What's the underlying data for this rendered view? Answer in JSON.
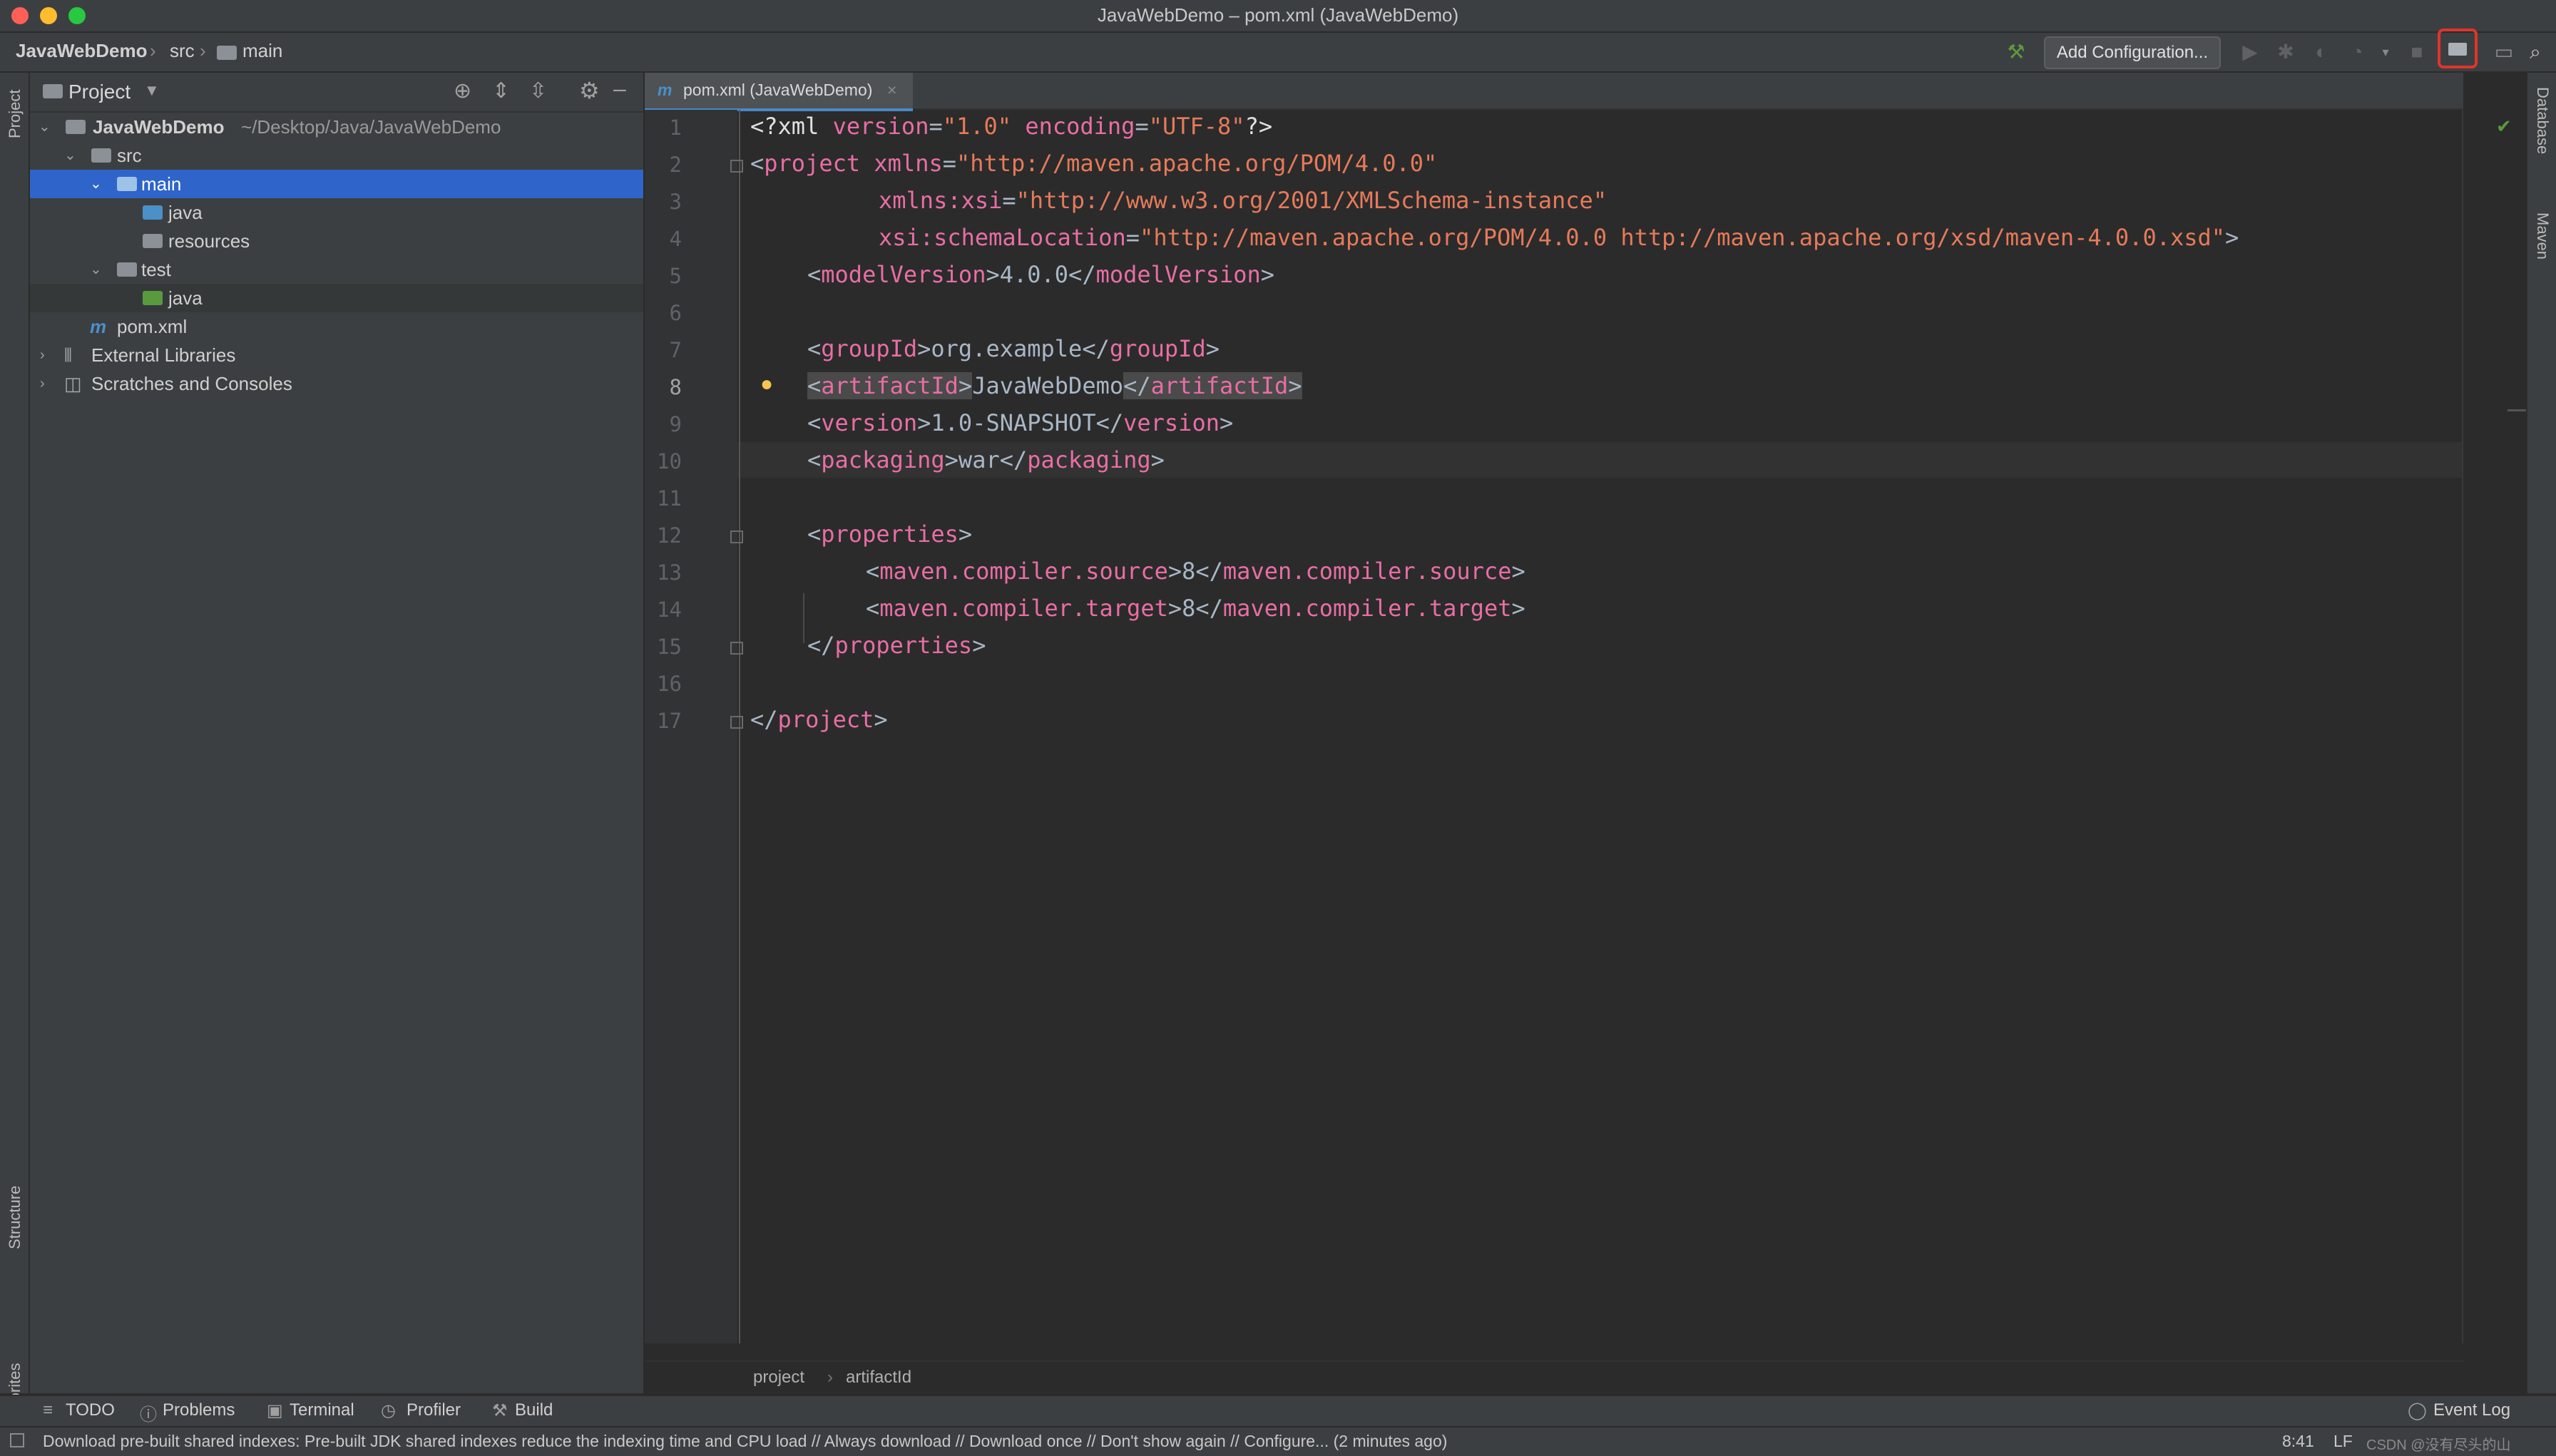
{
  "window": {
    "title": "JavaWebDemo – pom.xml (JavaWebDemo)"
  },
  "breadcrumb": {
    "project": "JavaWebDemo",
    "src": "src",
    "main": "main"
  },
  "toolbar": {
    "add_config_label": "Add Configuration..."
  },
  "left_strip": {
    "project_tab": "Project",
    "structure_tab": "Structure",
    "favorites_tab": "Favorites"
  },
  "right_strip": {
    "database_tab": "Database",
    "maven_tab": "Maven"
  },
  "project_panel": {
    "title": "Project",
    "tree": [
      {
        "label": "JavaWebDemo",
        "hint": "~/Desktop/Java/JavaWebDemo"
      },
      {
        "label": "src"
      },
      {
        "label": "main"
      },
      {
        "label": "java"
      },
      {
        "label": "resources"
      },
      {
        "label": "test"
      },
      {
        "label": "java"
      },
      {
        "label": "pom.xml"
      },
      {
        "label": "External Libraries"
      },
      {
        "label": "Scratches and Consoles"
      }
    ]
  },
  "editor": {
    "tab_label": "pom.xml (JavaWebDemo)",
    "line_numbers": [
      "1",
      "2",
      "3",
      "4",
      "5",
      "6",
      "7",
      "8",
      "9",
      "10",
      "11",
      "12",
      "13",
      "14",
      "15",
      "16",
      "17"
    ],
    "breadcrumb": {
      "first": "project",
      "second": "artifactId"
    },
    "code": {
      "l1_open": "<?xml ",
      "l1_ver_attr": "version",
      "l1_ver_val": "\"1.0\"",
      "l1_enc_attr": " encoding",
      "l1_enc_val": "\"UTF-8\"",
      "l1_close": "?>",
      "l2_tag": "project",
      "l2_attr": " xmlns",
      "l2_val": "\"http://maven.apache.org/POM/4.0.0\"",
      "l3_attr": "xmlns:xsi",
      "l3_val": "\"http://www.w3.org/2001/XMLSchema-instance\"",
      "l4_attr": "xsi:schemaLocation",
      "l4_val": "\"http://maven.apache.org/POM/4.0.0 http://maven.apache.org/xsd/maven-4.0.0.xsd\"",
      "l5_tag": "modelVersion",
      "l5_text": "4.0.0",
      "l7_tag": "groupId",
      "l7_text": "org.example",
      "l8_tag": "artifactId",
      "l8_text": "JavaWebDemo",
      "l9_tag": "version",
      "l9_text": "1.0-SNAPSHOT",
      "l10_tag": "packaging",
      "l10_text": "war",
      "l12_tag": "properties",
      "l13_tag": "maven.compiler.source",
      "l13_text": "8",
      "l14_tag": "maven.compiler.target",
      "l14_text": "8",
      "l17_tag": "project"
    }
  },
  "bottom_tools": {
    "todo": "TODO",
    "problems": "Problems",
    "terminal": "Terminal",
    "profiler": "Profiler",
    "build": "Build",
    "event_log": "Event Log"
  },
  "status": {
    "message": "Download pre-built shared indexes: Pre-built JDK shared indexes reduce the indexing time and CPU load // Always download // Download once // Don't show again // Configure... (2 minutes ago)",
    "position": "8:41",
    "line_sep": "LF",
    "watermark": "CSDN @没有尽头的山"
  },
  "colors": {
    "selection": "#2f65ca",
    "highlight_box": "#e0342c",
    "accent_tab": "#4a88c7"
  }
}
